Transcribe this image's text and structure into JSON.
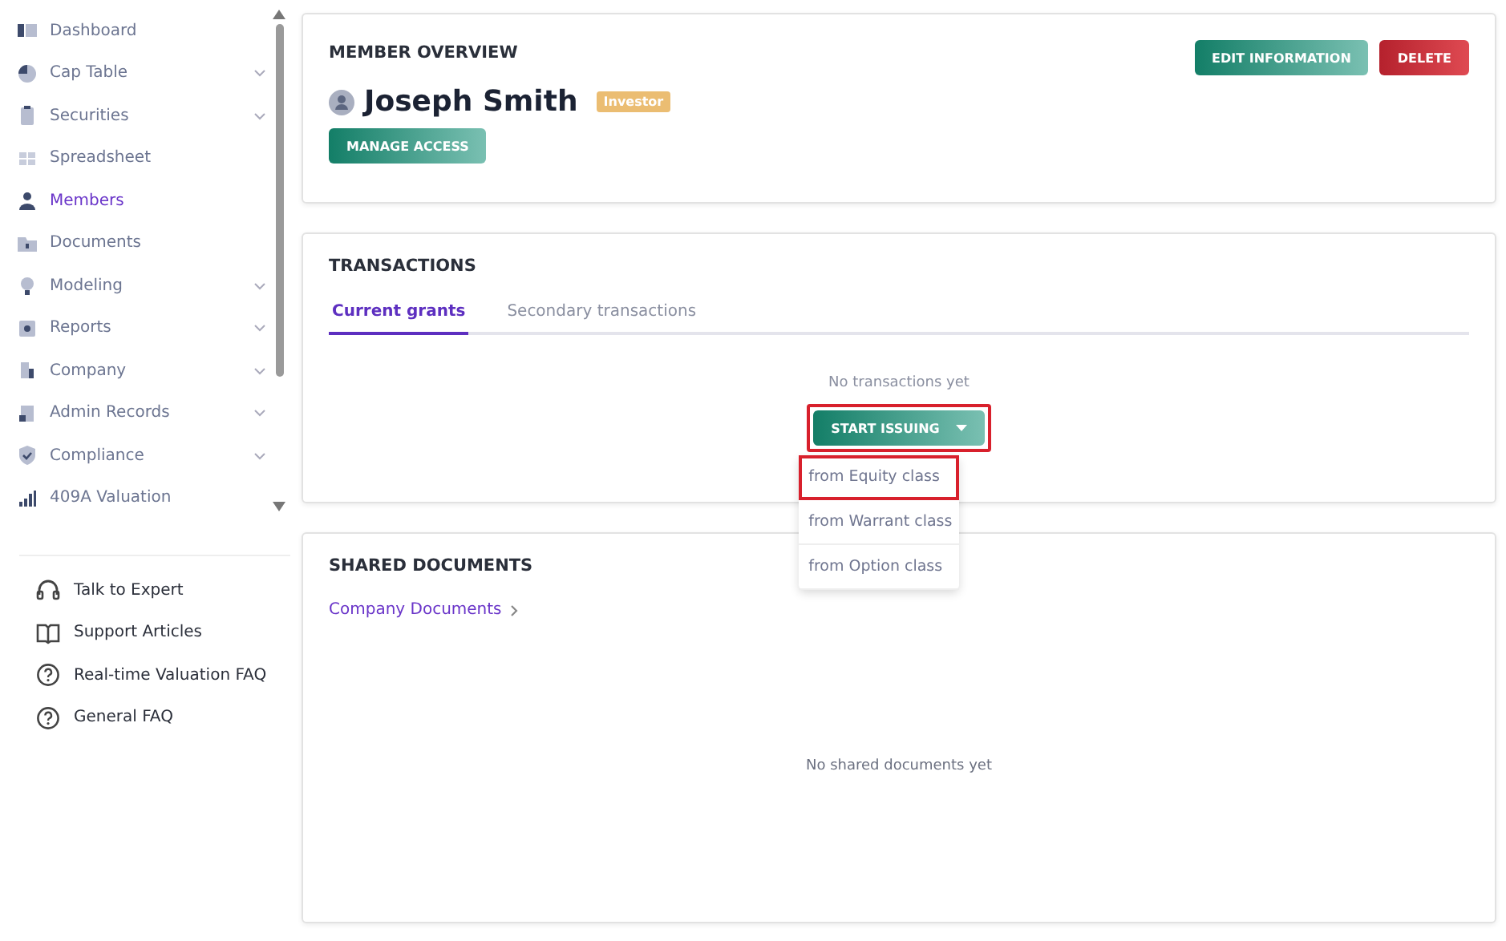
{
  "sidebar": {
    "items": [
      {
        "label": "Dashboard",
        "selected": false,
        "expandable": false
      },
      {
        "label": "Cap Table",
        "selected": false,
        "expandable": true
      },
      {
        "label": "Securities",
        "selected": false,
        "expandable": true
      },
      {
        "label": "Spreadsheet",
        "selected": false,
        "expandable": false
      },
      {
        "label": "Members",
        "selected": true,
        "expandable": false
      },
      {
        "label": "Documents",
        "selected": false,
        "expandable": false
      },
      {
        "label": "Modeling",
        "selected": false,
        "expandable": true
      },
      {
        "label": "Reports",
        "selected": false,
        "expandable": true
      },
      {
        "label": "Company",
        "selected": false,
        "expandable": true
      },
      {
        "label": "Admin Records",
        "selected": false,
        "expandable": true
      },
      {
        "label": "Compliance",
        "selected": false,
        "expandable": true
      },
      {
        "label": "409A Valuation",
        "selected": false,
        "expandable": false
      }
    ],
    "help_links": [
      {
        "label": "Talk to Expert"
      },
      {
        "label": "Support Articles"
      },
      {
        "label": "Real-time Valuation FAQ"
      },
      {
        "label": "General FAQ"
      }
    ]
  },
  "member_overview": {
    "title": "MEMBER OVERVIEW",
    "name": "Joseph Smith",
    "badge": "Investor",
    "buttons": [
      {
        "label": "EDIT INFORMATION",
        "kind": "primary"
      },
      {
        "label": "DELETE",
        "kind": "danger"
      }
    ],
    "manage_button": "MANAGE ACCESS"
  },
  "transactions": {
    "title": "TRANSACTIONS",
    "tabs": [
      {
        "label": "Current grants",
        "selected": true
      },
      {
        "label": "Secondary transactions",
        "selected": false
      }
    ],
    "empty_text": "No transactions yet",
    "start_button": {
      "label": "START ISSUING",
      "highlighted": true
    },
    "menu": [
      {
        "label": "from Equity class",
        "highlighted": true
      },
      {
        "label": "from Warrant class",
        "highlighted": false
      },
      {
        "label": "from Option class",
        "highlighted": false
      }
    ]
  },
  "shared_documents": {
    "title": "SHARED DOCUMENTS",
    "link": "Company Documents",
    "empty_text": "No shared documents yet"
  }
}
